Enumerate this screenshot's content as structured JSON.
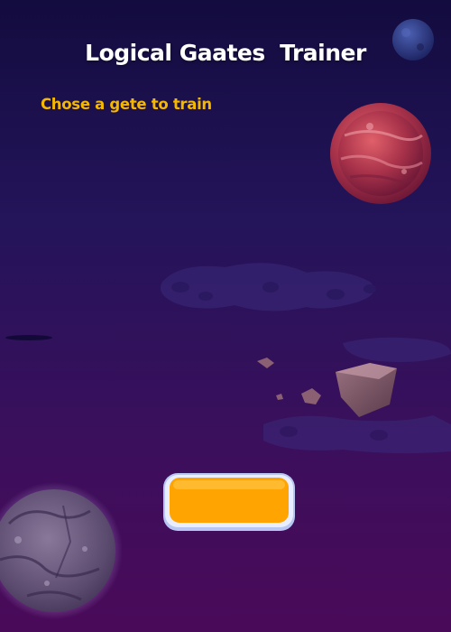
{
  "header": {
    "title": "Logical Gaates  Trainer",
    "subtitle": "Chose a gete to train"
  },
  "start_button": {
    "label": ""
  },
  "colors": {
    "title": "#ffffff",
    "subtitle": "#f5b800",
    "button_fill": "#ffa400",
    "button_border": "#c8d6ff",
    "background_top": "#130c3f",
    "background_bottom": "#4a0a5a"
  },
  "decorations": {
    "planets": [
      "blue-planet",
      "red-planet",
      "grey-planet"
    ],
    "asteroids": [
      "large-asteroid",
      "small-asteroid",
      "tiny-asteroid"
    ],
    "clouds": [
      "space-cloud"
    ]
  }
}
